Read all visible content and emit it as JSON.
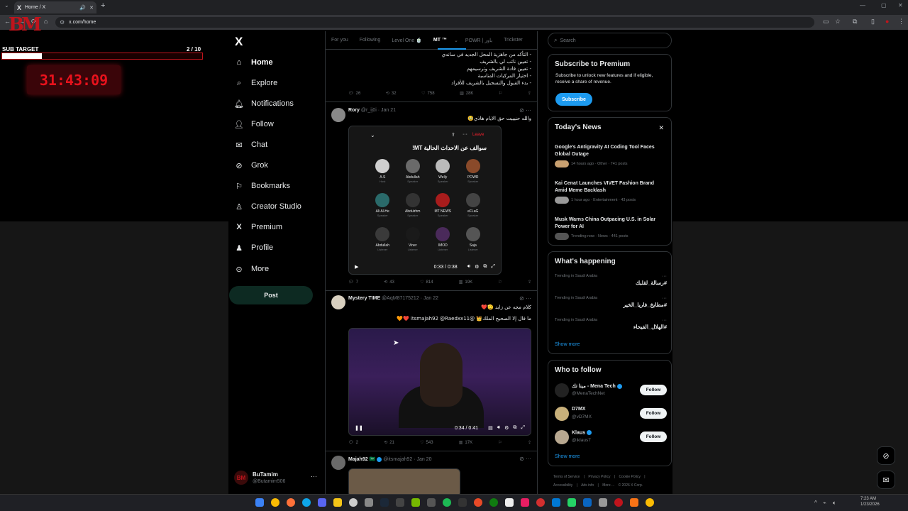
{
  "browser": {
    "tab_title": "Home / X",
    "tab_logo": "X",
    "url": "x.com/home"
  },
  "overlay": {
    "logo_text": "BM",
    "sub_target_label": "SUB TARGET",
    "sub_target_count": "2 / 10",
    "sub_target_progress": 0.2,
    "timer": "31:43:09"
  },
  "sidebar": {
    "logo": "X",
    "items": [
      {
        "label": "Home",
        "icon": "home-icon"
      },
      {
        "label": "Explore",
        "icon": "search-icon"
      },
      {
        "label": "Notifications",
        "icon": "bell-icon"
      },
      {
        "label": "Follow",
        "icon": "person-add-icon"
      },
      {
        "label": "Chat",
        "icon": "mail-icon"
      },
      {
        "label": "Grok",
        "icon": "grok-icon"
      },
      {
        "label": "Bookmarks",
        "icon": "bookmark-icon"
      },
      {
        "label": "Creator Studio",
        "icon": "creator-icon"
      },
      {
        "label": "Premium",
        "icon": "x-icon"
      },
      {
        "label": "Profile",
        "icon": "person-icon"
      },
      {
        "label": "More",
        "icon": "more-icon"
      }
    ],
    "post_label": "Post",
    "profile": {
      "name": "BuTamim",
      "handle": "@Butamim506",
      "avatar_text": "BM"
    }
  },
  "timeline": {
    "tabs": [
      "For you",
      "Following",
      "Level One 🍵",
      "MT ™",
      "POWR | باور",
      "Trickster"
    ],
    "tweet0": {
      "lines": [
        "- التأكد من جاهزية المحل الجديد في ساندي",
        "- تعيين نائب لي بالشريف",
        "- تعيين قادة الشريف وترسيمهم",
        "- اختيار المركبات المناسبة",
        "- بدء القبول والتسجيل بالشريف للأفراد"
      ],
      "replies": "26",
      "reposts": "32",
      "likes": "758",
      "views": "28K"
    },
    "tweet1": {
      "name": "Rory",
      "handle": "@r_ij0i",
      "date": "Jan 21",
      "text": "والله حنيييت حق الايام هاذي🥹",
      "space_title": "سوالف عن الاحداث الحالية MT!",
      "space_leave": "Leave",
      "space_people": [
        {
          "name": "A.S",
          "role": "Host"
        },
        {
          "name": "Abdullah",
          "role": "Speaker"
        },
        {
          "name": "Welly",
          "role": "Speaker"
        },
        {
          "name": "POWR",
          "role": "Speaker"
        },
        {
          "name": "Ali Al-He",
          "role": "Speaker"
        },
        {
          "name": "Abdulrhm",
          "role": "Speaker"
        },
        {
          "name": "MT NEWS",
          "role": "Speaker"
        },
        {
          "name": "eFLaG",
          "role": "Speaker"
        },
        {
          "name": "Abdullah",
          "role": "Listener"
        },
        {
          "name": "Viner",
          "role": "Listener"
        },
        {
          "name": "IMOD",
          "role": "Listener"
        },
        {
          "name": "Saja",
          "role": "Listener"
        }
      ],
      "video_time": "0:33 / 0:38",
      "replies": "7",
      "reposts": "43",
      "likes": "814",
      "views": "19K"
    },
    "tweet2": {
      "name": "Mystery TIME",
      "handle": "@AqM87175212",
      "date": "Jan 22",
      "text1": "كلام مجه عن زايد 🫡❤️",
      "text2": "ما قال إلا الصحيح الملك👑 @itsmajah92 @Raedxx11 ❤️🧡",
      "video_time": "0:34 / 0:41",
      "replies": "2",
      "reposts": "21",
      "likes": "543",
      "views": "17K"
    },
    "tweet3": {
      "name": "Majah92 🇸🇦",
      "handle": "@itsmajah92",
      "date": "Jan 20"
    }
  },
  "right": {
    "search_placeholder": "Search",
    "premium": {
      "title": "Subscribe to Premium",
      "desc": "Subscribe to unlock new features and if eligible, receive a share of revenue.",
      "button": "Subscribe"
    },
    "news": {
      "title": "Today's News",
      "items": [
        {
          "headline": "Google's Antigravity AI Coding Tool Faces Global Outage",
          "meta": "14 hours ago · Other · 741 posts"
        },
        {
          "headline": "Kai Cenat Launches VIVET Fashion Brand Amid Meme Backlash",
          "meta": "1 hour ago · Entertainment · 43 posts"
        },
        {
          "headline": "Musk Warns China Outpacing U.S. in Solar Power for AI",
          "meta": "Trending now · News · 441 posts"
        }
      ]
    },
    "happening": {
      "title": "What's happening",
      "trends": [
        {
          "category": "Trending in Saudi Arabia",
          "name": "#رسالة_لقلبك"
        },
        {
          "category": "Trending in Saudi Arabia",
          "name": "#مطابخ_فاريا_الخير"
        },
        {
          "category": "Trending in Saudi Arabia",
          "name": "#الهلال_الفيحاء"
        }
      ],
      "show_more": "Show more"
    },
    "wtf": {
      "title": "Who to follow",
      "accounts": [
        {
          "name": "مينا تك - Mena Tech",
          "handle": "@MenaTechNet",
          "button": "Follow"
        },
        {
          "name": "D7MX",
          "handle": "@vD7MX",
          "button": "Follow"
        },
        {
          "name": "Klaus",
          "handle": "@iklaus7",
          "button": "Follow"
        }
      ],
      "show_more": "Show more"
    },
    "footer": {
      "line1": [
        "Terms of Service",
        "|",
        "Privacy Policy",
        "|",
        "Cookie Policy",
        "|"
      ],
      "line2": [
        "Accessibility",
        "|",
        "Ads info",
        "|",
        "More ...",
        "© 2026 X Corp."
      ]
    }
  },
  "taskbar": {
    "time": "7:23 AM",
    "date": "1/23/2026"
  },
  "colors": {
    "accent": "#1d9bf0",
    "brand_red": "#c0141c",
    "timer_bg": "#3a0509"
  }
}
